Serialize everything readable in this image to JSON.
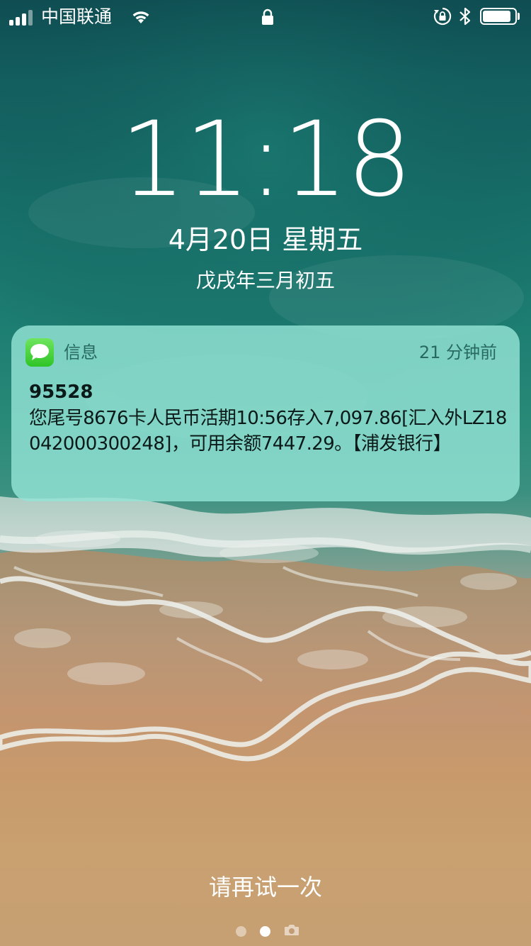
{
  "status_bar": {
    "carrier": "中国联通",
    "battery_level": 0.88,
    "icons": [
      "signal-icon",
      "wifi-icon",
      "lock-icon",
      "rotation-lock-icon",
      "bluetooth-icon",
      "battery-icon"
    ]
  },
  "lock_screen": {
    "time": "11:18",
    "date": "4月20日 星期五",
    "lunar_date": "戊戌年三月初五"
  },
  "notification": {
    "app_name": "信息",
    "time_ago": "21 分钟前",
    "sender": "95528",
    "body": "您尾号8676卡人民币活期10:56存入7,097.86[汇入外LZ18042000300248]，可用余额7447.29。【浦发银行】",
    "icon": "messages-icon"
  },
  "bottom": {
    "retry_text": "请再试一次",
    "page_dots": 2,
    "active_page": 2,
    "camera_icon": "camera-icon"
  },
  "colors": {
    "notification_bg": "#94e4d5",
    "notification_meta_text": "#286a62",
    "messages_icon_green": "#3fd33a"
  }
}
